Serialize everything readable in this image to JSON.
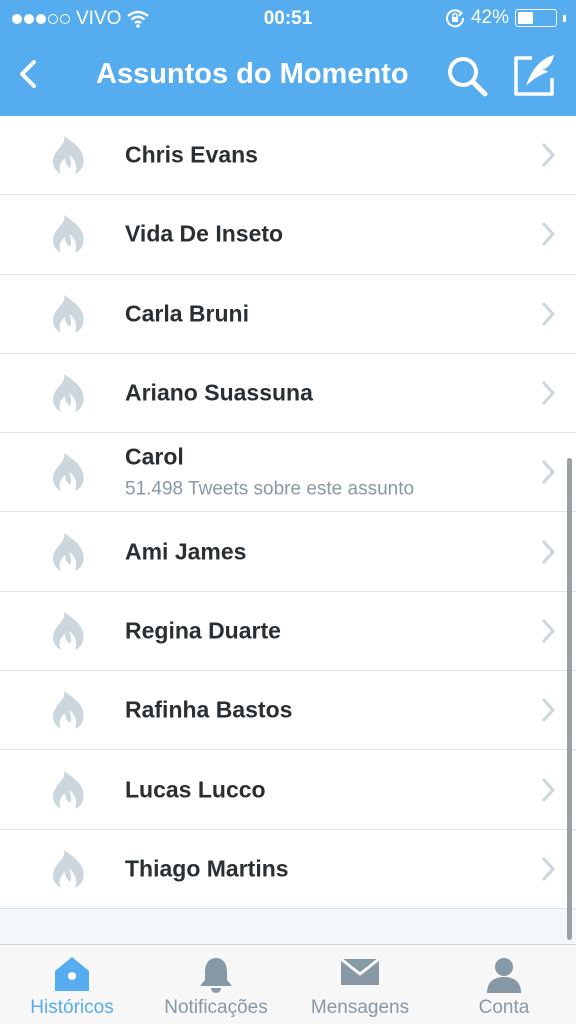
{
  "status_bar": {
    "carrier": "VIVO",
    "time": "00:51",
    "battery_text": "42%",
    "battery_level": 0.42,
    "signal_bars_filled": 3,
    "signal_bars_total": 5
  },
  "nav": {
    "title": "Assuntos do Momento",
    "back_icon": "chevron-left-icon",
    "search_icon": "search-icon",
    "compose_icon": "compose-icon"
  },
  "trends": [
    {
      "title": "Chris Evans",
      "subtitle": ""
    },
    {
      "title": "Vida De Inseto",
      "subtitle": ""
    },
    {
      "title": "Carla Bruni",
      "subtitle": ""
    },
    {
      "title": "Ariano Suassuna",
      "subtitle": ""
    },
    {
      "title": "Carol",
      "subtitle": "51.498 Tweets sobre este assunto"
    },
    {
      "title": "Ami James",
      "subtitle": ""
    },
    {
      "title": "Regina Duarte",
      "subtitle": ""
    },
    {
      "title": "Rafinha Bastos",
      "subtitle": ""
    },
    {
      "title": "Lucas Lucco",
      "subtitle": ""
    },
    {
      "title": "Thiago Martins",
      "subtitle": ""
    }
  ],
  "tabs": [
    {
      "label": "Históricos",
      "icon": "home-icon",
      "active": true
    },
    {
      "label": "Notificações",
      "icon": "bell-icon",
      "active": false
    },
    {
      "label": "Mensagens",
      "icon": "envelope-icon",
      "active": false
    },
    {
      "label": "Conta",
      "icon": "person-icon",
      "active": false
    }
  ],
  "colors": {
    "brand": "#55acee",
    "icon_gray": "#ccd6dd",
    "text_dark": "#292f33",
    "text_gray": "#8899a6"
  }
}
